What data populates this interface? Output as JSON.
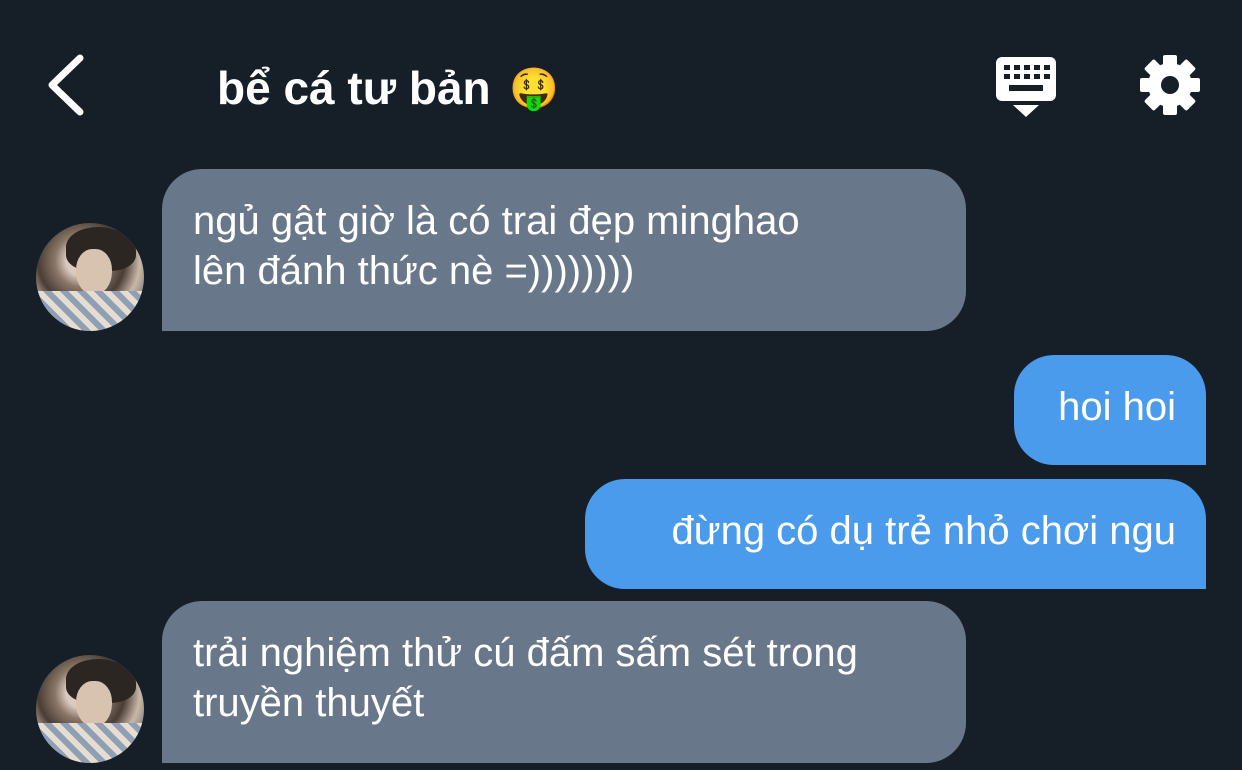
{
  "header": {
    "title": "bể cá tư bản",
    "title_emoji": "🤑"
  },
  "messages": [
    {
      "direction": "incoming",
      "text": "ngủ gật giờ là có trai đẹp minghao\nlên đánh thức nè =))))))))"
    },
    {
      "direction": "outgoing",
      "text": "hoi hoi"
    },
    {
      "direction": "outgoing",
      "text": "đừng có dụ trẻ nhỏ chơi ngu"
    },
    {
      "direction": "incoming",
      "text": "trải nghiệm thử cú đấm sấm sét trong\ntruyền thuyết"
    }
  ],
  "colors": {
    "background": "#161e28",
    "incoming_bubble": "#68778a",
    "outgoing_bubble": "#4a9bec",
    "text": "#ffffff"
  },
  "icons": {
    "back": "chevron-left-icon",
    "keyboard": "keyboard-icon",
    "settings": "gear-icon"
  }
}
